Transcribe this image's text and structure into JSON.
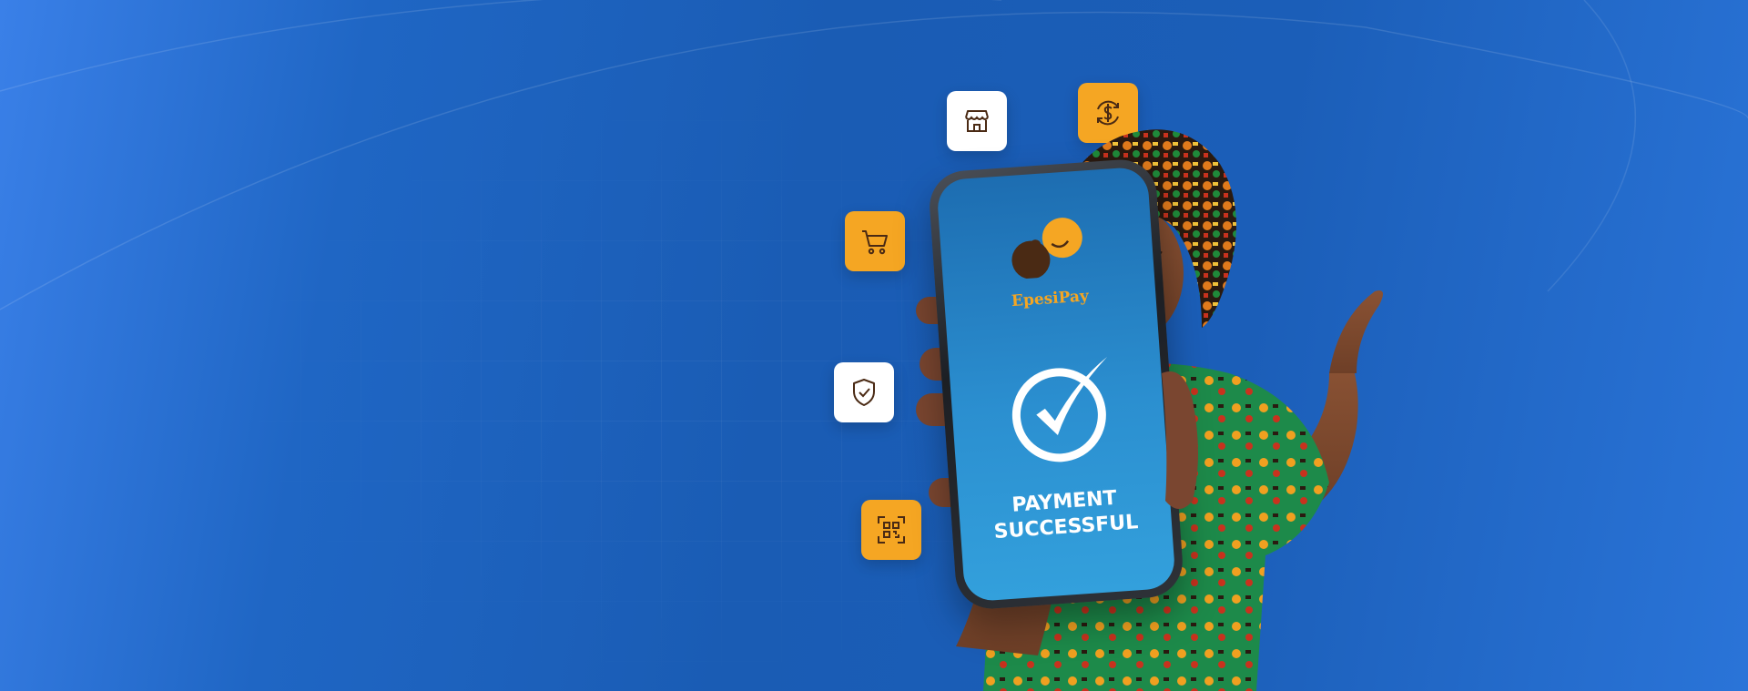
{
  "phone_screen": {
    "brand_name": "EpesiPay",
    "status_line_1": "PAYMENT",
    "status_line_2": "SUCCESSFUL"
  },
  "floating_icons": [
    {
      "name": "store-icon",
      "style": "white"
    },
    {
      "name": "dollar-exchange-icon",
      "style": "orange"
    },
    {
      "name": "shopping-cart-icon",
      "style": "orange"
    },
    {
      "name": "shield-check-icon",
      "style": "white"
    },
    {
      "name": "qr-scan-icon",
      "style": "orange"
    }
  ],
  "colors": {
    "background": "#1b5eb8",
    "accent_orange": "#f5a623",
    "icon_brown": "#4a2a14",
    "screen_blue": "#2b8fd0"
  }
}
